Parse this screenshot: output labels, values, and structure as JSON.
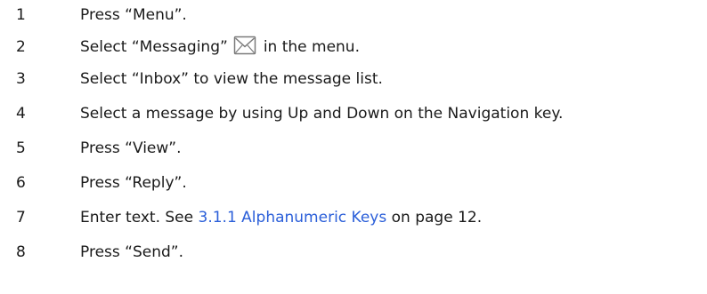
{
  "steps": [
    {
      "number": "1",
      "text": "Press “Menu”."
    },
    {
      "number": "2",
      "before": "Select “Messaging”",
      "icon": "messaging-envelope-icon",
      "after": "in the menu."
    },
    {
      "number": "3",
      "text": "Select “Inbox” to view the message list."
    },
    {
      "number": "4",
      "text": "Select a message by using Up and Down on the Navigation key."
    },
    {
      "number": "5",
      "text": "Press “View”."
    },
    {
      "number": "6",
      "text": "Press “Reply”."
    },
    {
      "number": "7",
      "before": "Enter text. See ",
      "link": "3.1.1 Alphanumeric Keys",
      "after": " on page 12."
    },
    {
      "number": "8",
      "text": "Press “Send”."
    }
  ],
  "colors": {
    "text": "#1a1a1a",
    "link": "#2b5fd9",
    "icon_stroke": "#7a7a7a"
  }
}
